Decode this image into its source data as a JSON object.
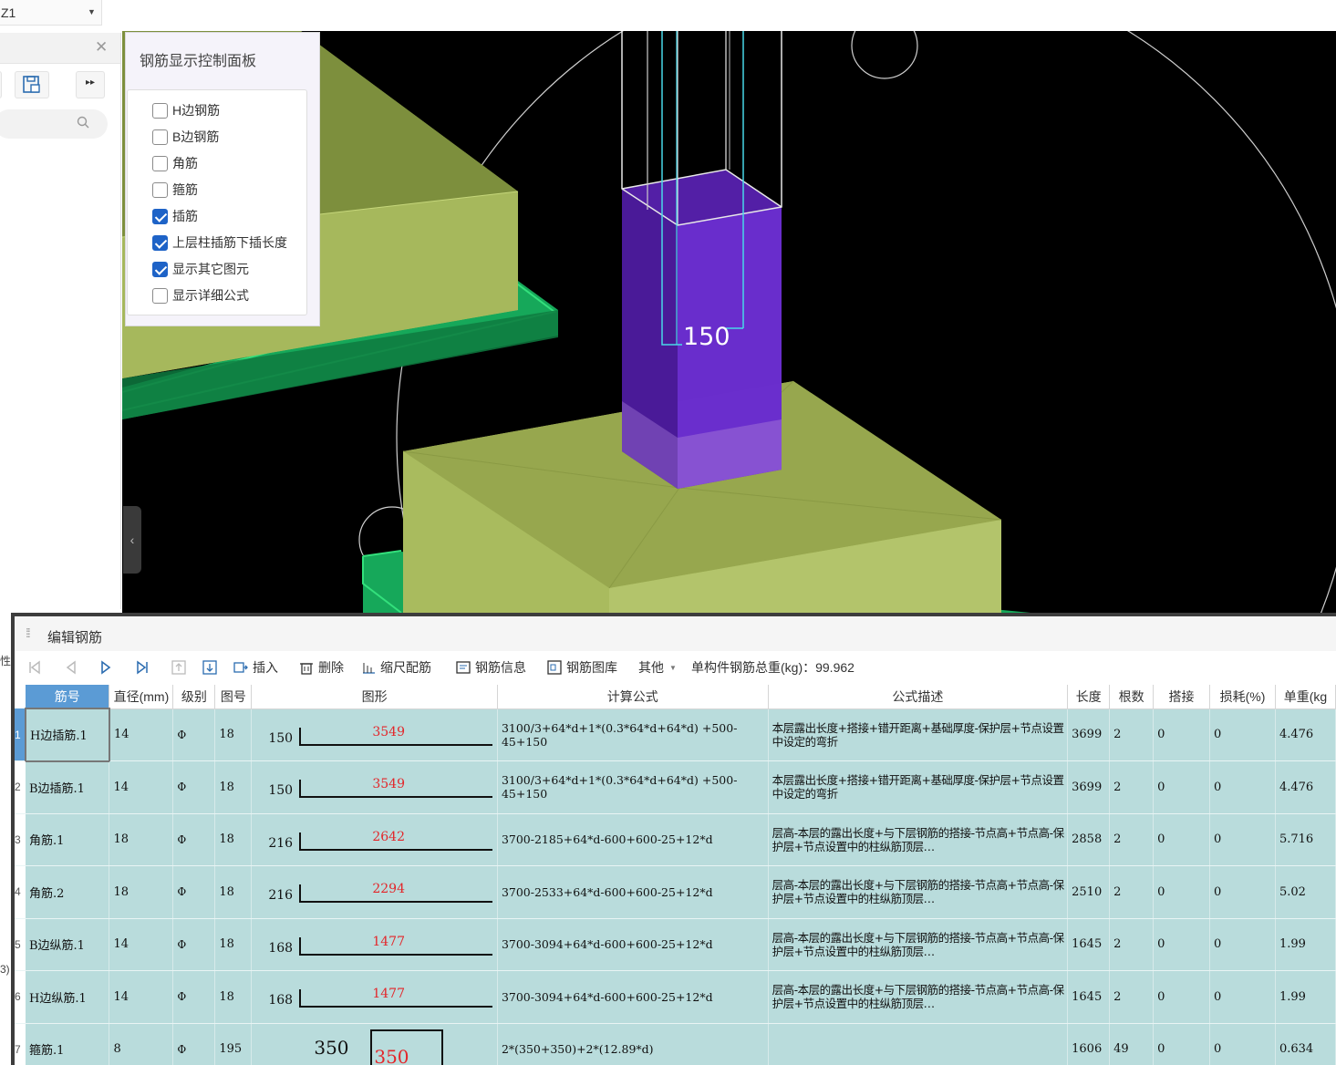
{
  "top_selector": {
    "value": "Z1",
    "arrow_icon": "chevron-down-icon"
  },
  "left_panel": {
    "close_icon": "close-icon",
    "save_icon": "save-icon",
    "more_icon": "double-chevron-right-icon",
    "search_icon": "search-icon"
  },
  "left_remnants": [
    "性",
    "3)"
  ],
  "control_panel": {
    "title": "钢筋显示控制面板",
    "options": [
      {
        "label": "H边钢筋",
        "checked": false
      },
      {
        "label": "B边钢筋",
        "checked": false
      },
      {
        "label": "角筋",
        "checked": false
      },
      {
        "label": "箍筋",
        "checked": false
      },
      {
        "label": "插筋",
        "checked": true
      },
      {
        "label": "上层柱插筋下插长度",
        "checked": true
      },
      {
        "label": "显示其它图元",
        "checked": true
      },
      {
        "label": "显示详细公式",
        "checked": false
      }
    ]
  },
  "viewport": {
    "dimension_label": "150",
    "colors": {
      "footing": "#a6b85c",
      "slab": "#1fb868",
      "column": "#6a2cc4"
    }
  },
  "editor": {
    "title": "编辑钢筋",
    "toolbar": {
      "insert": "插入",
      "delete": "删除",
      "scale": "缩尺配筋",
      "info": "钢筋信息",
      "library": "钢筋图库",
      "other": "其他",
      "total_weight": "单构件钢筋总重(kg)：99.962"
    },
    "columns": [
      "筋号",
      "直径(mm)",
      "级别",
      "图号",
      "图形",
      "计算公式",
      "公式描述",
      "长度",
      "根数",
      "搭接",
      "损耗(%)",
      "单重(kg"
    ],
    "rows": [
      {
        "no": "1",
        "name": "H边插筋.1",
        "dia": "14",
        "grade": "Φ",
        "fig": "18",
        "lead": "150",
        "len_label": "3549",
        "formula": "3100/3+64*d+1*(0.3*64*d+64*d) +500-45+150",
        "desc": "本层露出长度+搭接+错开距离+基础厚度-保护层+节点设置中设定的弯折",
        "length": "3699",
        "count": "2",
        "lap": "0",
        "loss": "0",
        "weight": "4.476"
      },
      {
        "no": "2",
        "name": "B边插筋.1",
        "dia": "14",
        "grade": "Φ",
        "fig": "18",
        "lead": "150",
        "len_label": "3549",
        "formula": "3100/3+64*d+1*(0.3*64*d+64*d) +500-45+150",
        "desc": "本层露出长度+搭接+错开距离+基础厚度-保护层+节点设置中设定的弯折",
        "length": "3699",
        "count": "2",
        "lap": "0",
        "loss": "0",
        "weight": "4.476"
      },
      {
        "no": "3",
        "name": "角筋.1",
        "dia": "18",
        "grade": "Φ",
        "fig": "18",
        "lead": "216",
        "len_label": "2642",
        "formula": "3700-2185+64*d-600+600-25+12*d",
        "desc": "层高-本层的露出长度+与下层钢筋的搭接-节点高+节点高-保护层+节点设置中的柱纵筋顶层…",
        "length": "2858",
        "count": "2",
        "lap": "0",
        "loss": "0",
        "weight": "5.716"
      },
      {
        "no": "4",
        "name": "角筋.2",
        "dia": "18",
        "grade": "Φ",
        "fig": "18",
        "lead": "216",
        "len_label": "2294",
        "formula": "3700-2533+64*d-600+600-25+12*d",
        "desc": "层高-本层的露出长度+与下层钢筋的搭接-节点高+节点高-保护层+节点设置中的柱纵筋顶层…",
        "length": "2510",
        "count": "2",
        "lap": "0",
        "loss": "0",
        "weight": "5.02"
      },
      {
        "no": "5",
        "name": "B边纵筋.1",
        "dia": "14",
        "grade": "Φ",
        "fig": "18",
        "lead": "168",
        "len_label": "1477",
        "formula": "3700-3094+64*d-600+600-25+12*d",
        "desc": "层高-本层的露出长度+与下层钢筋的搭接-节点高+节点高-保护层+节点设置中的柱纵筋顶层…",
        "length": "1645",
        "count": "2",
        "lap": "0",
        "loss": "0",
        "weight": "1.99"
      },
      {
        "no": "6",
        "name": "H边纵筋.1",
        "dia": "14",
        "grade": "Φ",
        "fig": "18",
        "lead": "168",
        "len_label": "1477",
        "formula": "3700-3094+64*d-600+600-25+12*d",
        "desc": "层高-本层的露出长度+与下层钢筋的搭接-节点高+节点高-保护层+节点设置中的柱纵筋顶层…",
        "length": "1645",
        "count": "2",
        "lap": "0",
        "loss": "0",
        "weight": "1.99"
      },
      {
        "no": "7",
        "name": "箍筋.1",
        "dia": "8",
        "grade": "Φ",
        "fig": "195",
        "lead": "350",
        "len_label": "350",
        "formula": "2*(350+350)+2*(12.89*d)",
        "desc": "",
        "length": "1606",
        "count": "49",
        "lap": "0",
        "loss": "0",
        "weight": "0.634"
      }
    ]
  }
}
